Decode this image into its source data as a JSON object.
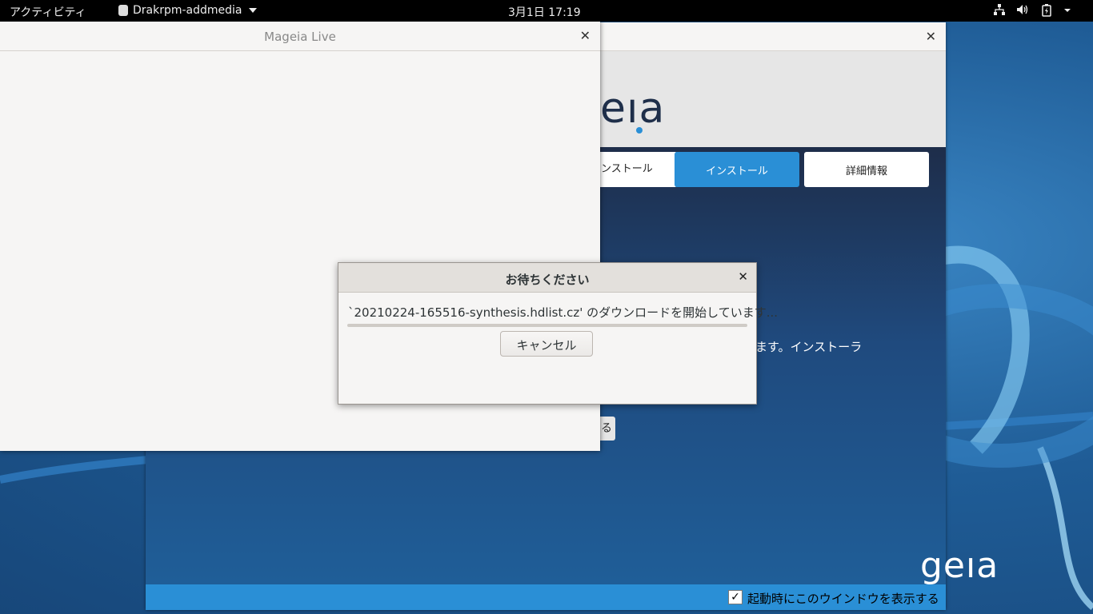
{
  "topbar": {
    "activities": "アクティビティ",
    "app_name": "Drakrpm-addmedia",
    "clock": "3月1日  17:19",
    "tray_icons": [
      "network-icon",
      "volume-icon",
      "battery-icon"
    ]
  },
  "welcome_window": {
    "logo_text": "eıa",
    "buttons": {
      "install_software": "アのインストール",
      "install": "インストール",
      "more_info": "詳細情報"
    },
    "body_text": "ます。インストーラ",
    "small_button": "る",
    "corner_logo": "geıa",
    "show_on_startup_checked": true,
    "show_on_startup_label": "起動時にこのウインドウを表示する"
  },
  "live_window": {
    "title": "Mageia Live"
  },
  "dialog": {
    "title": "お待ちください",
    "message": "`20210224-165516-synthesis.hdlist.cz' のダウンロードを開始しています...",
    "progress": 0,
    "cancel_label": "キャンセル"
  },
  "colors": {
    "accent": "#2a8fd6",
    "topbar": "#000000",
    "window_bg": "#f6f5f4"
  }
}
